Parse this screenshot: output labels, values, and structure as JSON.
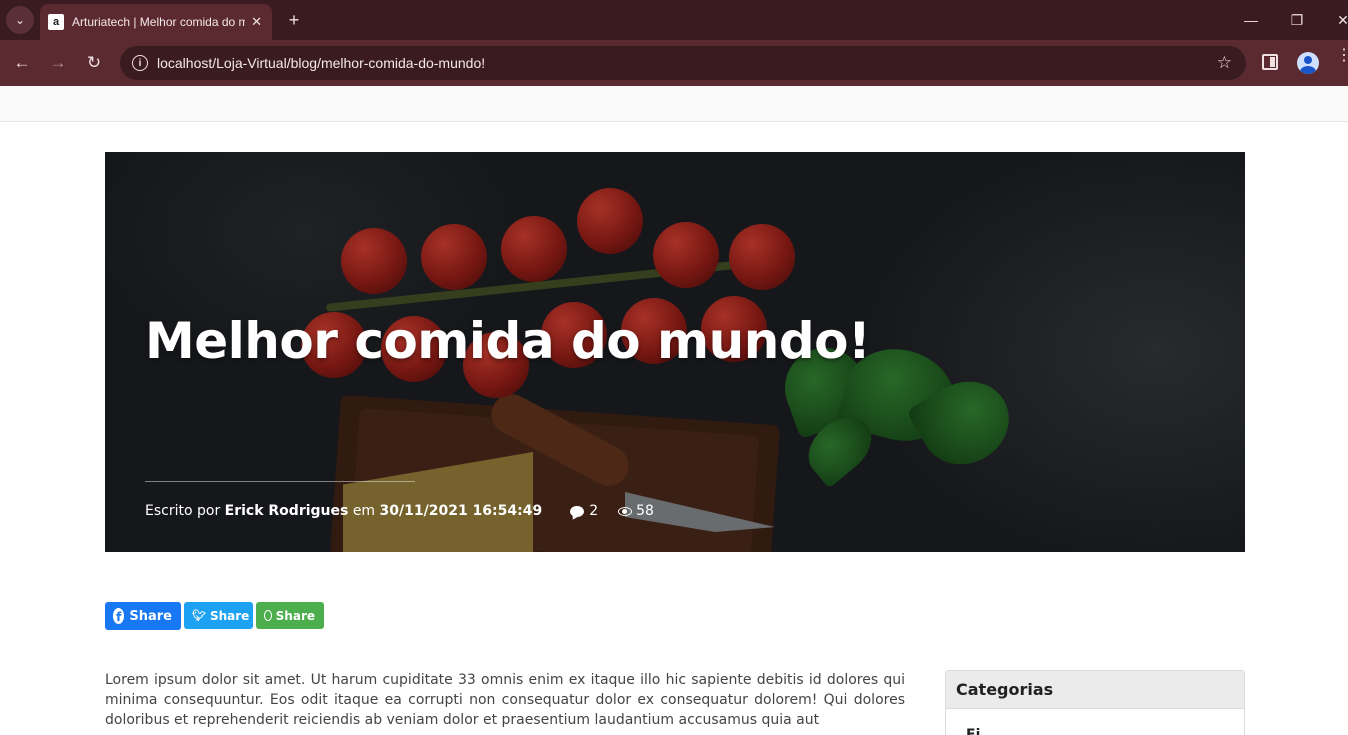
{
  "browser": {
    "tab_title": "Arturiatech | Melhor comida do mundo!",
    "favicon_letter": "a",
    "url": "localhost/Loja-Virtual/blog/melhor-comida-do-mundo!",
    "new_tab_symbol": "+",
    "tab_close_symbol": "✕",
    "minimize_symbol": "—",
    "restore_symbol": "❐",
    "window_close_symbol": "✕",
    "back_symbol": "←",
    "forward_symbol": "→",
    "reload_symbol": "↻",
    "info_symbol": "i",
    "star_symbol": "☆",
    "kebab_symbol": "⋮",
    "tab_menu_symbol": "⌄"
  },
  "post": {
    "title": "Melhor comida do mundo!",
    "written_by_label": "Escrito por",
    "author": "Erick Rodrigues",
    "date_connector": "em",
    "date": "30/11/2021 16:54:49",
    "comments": "2",
    "views": "58"
  },
  "share": {
    "facebook_label": "Share",
    "twitter_label": "Share",
    "whatsapp_label": "Share"
  },
  "article": {
    "body": "Lorem ipsum dolor sit amet. Ut harum cupiditate 33 omnis enim ex itaque illo hic sapiente debitis id dolores qui minima consequuntur. Eos odit itaque ea corrupti non consequatur dolor ex consequatur dolorem! Qui dolores doloribus et reprehenderit reiciendis ab veniam dolor et praesentium laudantium accusamus quia aut"
  },
  "sidebar": {
    "categories_title": "Categorias",
    "first_item": "Fi"
  }
}
